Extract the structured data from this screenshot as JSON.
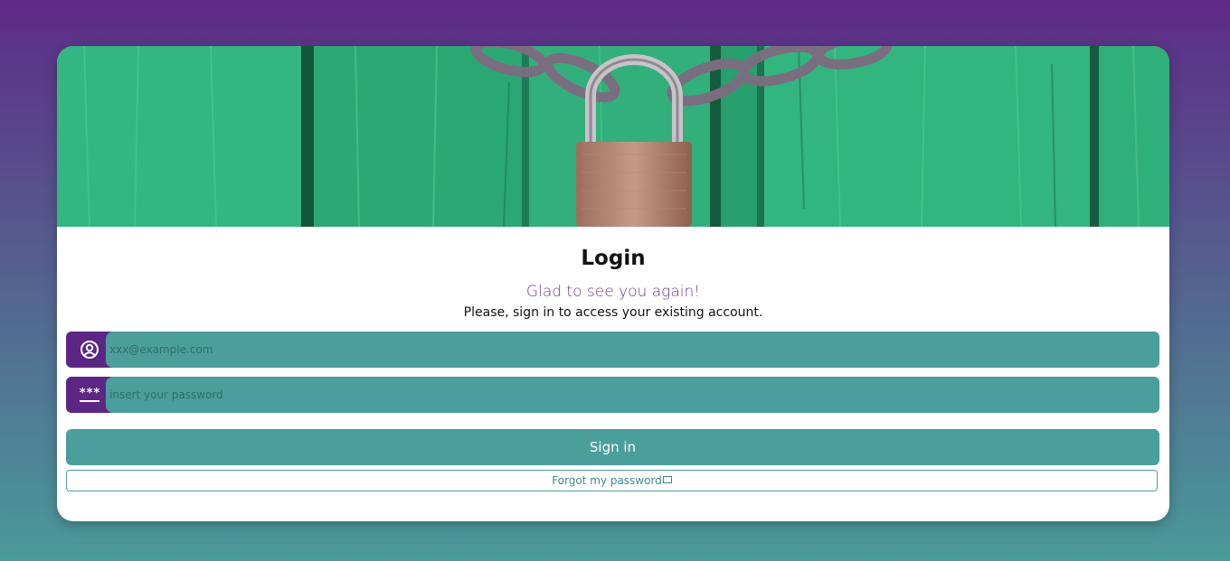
{
  "login": {
    "title": "Login",
    "subtitle": "Glad to see you again!",
    "description": "Please, sign in to access your existing account.",
    "email": {
      "placeholder": "xxx@example.com",
      "icon": "user-circle-icon"
    },
    "password": {
      "placeholder": "insert your password",
      "icon": "password-asterisks-icon",
      "icon_text": "***"
    },
    "signin_label": "Sign in",
    "forgot_label": "Forgot my password",
    "forgot_icon": "mail-icon"
  },
  "colors": {
    "accent": "#4a9e9c",
    "brand": "#5c2784",
    "subtitle": "#6a3a8c"
  }
}
